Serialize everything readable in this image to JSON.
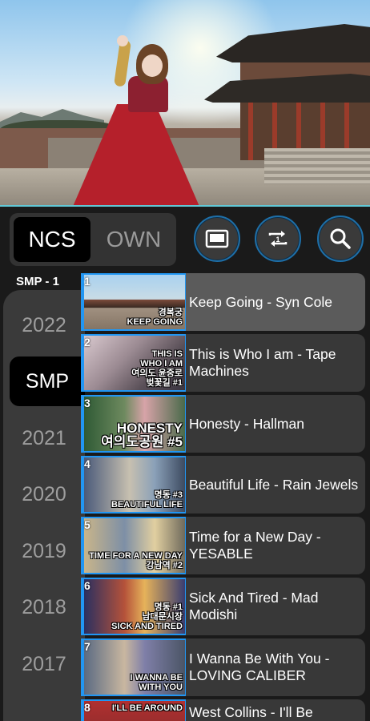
{
  "segment": {
    "options": [
      "NCS",
      "OWN"
    ],
    "selected": "NCS"
  },
  "toolbar": {
    "icons": [
      "picture-in-picture-icon",
      "repeat-one-icon",
      "search-icon"
    ]
  },
  "playlist_label": "SMP - 1",
  "years": [
    "2022",
    "SMP",
    "2021",
    "2020",
    "2019",
    "2018",
    "2017"
  ],
  "selected_year": "SMP",
  "tracks": [
    {
      "num": "1",
      "title": "Keep Going - Syn Cole",
      "thumb_text": "경복궁\nKEEP GOING",
      "thumb_bg": "#7a4a3a"
    },
    {
      "num": "2",
      "title": "This is Who I am - Tape Machines",
      "thumb_text": "THIS IS\nWHO I AM\n여의도 윤중로\n벚꽃길 #1",
      "thumb_bg": "#7b6f7a"
    },
    {
      "num": "3",
      "title": "Honesty - Hallman",
      "thumb_text": "HONESTY\n여의도공원 #5",
      "thumb_bg": "#4b6a4e"
    },
    {
      "num": "4",
      "title": "Beautiful Life - Rain Jewels",
      "thumb_text": "명동 #3\nBEAUTIFUL LIFE",
      "thumb_bg": "#5f6f88"
    },
    {
      "num": "5",
      "title": "Time for a New Day - YESABLE",
      "thumb_text": "TIME FOR A NEW DAY\n강남역 #2",
      "thumb_bg": "#8b7a5a"
    },
    {
      "num": "6",
      "title": "Sick And Tired - Mad Modishi",
      "thumb_text": "명동 #1\n남대문시장\nSICK AND TIRED",
      "thumb_bg": "#3c3f6e"
    },
    {
      "num": "7",
      "title": "I Wanna Be With You - LOVING CALIBER",
      "thumb_text": "I WANNA BE\nWITH YOU",
      "thumb_bg": "#5c6e84"
    },
    {
      "num": "8",
      "title": "West Collins - I'll Be",
      "thumb_text": "I'LL BE AROUND",
      "thumb_bg": "#8a3030"
    }
  ],
  "colors": {
    "accent": "#2196f3",
    "ring": "#1e6fa8",
    "panel": "#383838",
    "active_item": "#5b5b5b"
  }
}
